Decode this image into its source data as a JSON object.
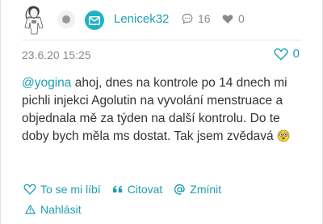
{
  "header": {
    "username": "Lenicek32",
    "comment_count": "16",
    "heart_count": "0"
  },
  "post": {
    "timestamp": "23.6.20 15:25",
    "like_count": "0",
    "mention": "@yogina",
    "text": " ahoj, dnes na kontrole po 14 dnech mi pichli injekci Agolutin na vyvolání menstruace a objednala mě za týden na další kontrolu. Do te doby bych měla ms dostat. Tak jsem zvědavá"
  },
  "actions": {
    "like_label": "To se mi líbí",
    "quote_label": "Citovat",
    "mention_label": "Zmínit",
    "report_label": "Nahlásit"
  },
  "colors": {
    "accent": "#1e9eb0",
    "mail_button": "#21b3c4",
    "muted": "#8a8a8a"
  },
  "icons": {
    "avatar": "woman-illustration-avatar",
    "status": "offline-dot-icon",
    "mail": "envelope-icon",
    "comments": "speech-bubble-icon",
    "hearts": "heart-icon",
    "like": "heart-outline-icon",
    "quote": "quote-icon",
    "mention": "at-sign-icon",
    "report": "warning-triangle-icon",
    "emoji": "curious-face-emoji"
  }
}
